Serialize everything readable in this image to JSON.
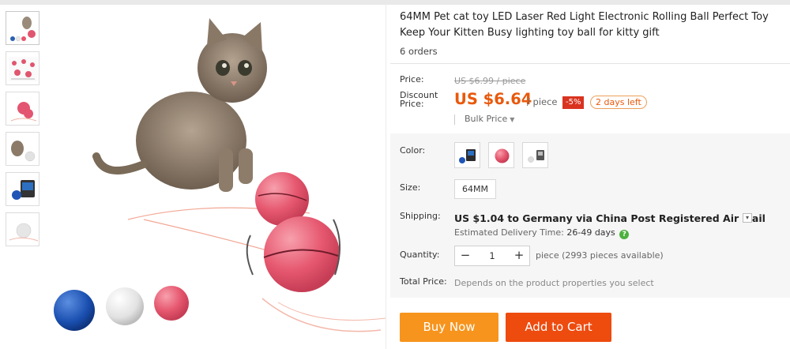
{
  "product": {
    "title": "64MM Pet cat toy LED Laser Red Light Electronic Rolling Ball Perfect Toy Keep Your Kitten Busy lighting toy ball for kitty gift",
    "orders": "6 orders"
  },
  "price": {
    "price_label": "Price:",
    "original": "US $6.99 / piece",
    "discount_label_line1": "Discount",
    "discount_label_line2": "Price:",
    "current": "US $6.64",
    "per_piece": "/ piece",
    "discount_badge": "-5%",
    "days_left": "2 days left",
    "bulk_label": "Bulk Price"
  },
  "options": {
    "color_label": "Color:",
    "colors": [
      "blue-ball",
      "pink-ball",
      "white-ball"
    ],
    "size_label": "Size:",
    "size_value": "64MM",
    "shipping_label": "Shipping:",
    "shipping_text": "US $1.04 to Germany via China Post Registered Air Mail",
    "delivery_prefix": "Estimated Delivery Time:",
    "delivery_days": "26-49 days",
    "help_icon": "?",
    "quantity_label": "Quantity:",
    "quantity_minus": "−",
    "quantity_value": "1",
    "quantity_plus": "+",
    "quantity_note": "piece (2993 pieces available)",
    "total_label": "Total Price:",
    "total_note": "Depends on the product properties you select"
  },
  "actions": {
    "buy_now": "Buy Now",
    "add_to_cart": "Add to Cart"
  },
  "colors": {
    "accent_orange": "#e8590c",
    "buy_button": "#f7941d",
    "cart_button": "#ee4b0f",
    "discount_badge": "#d9331f"
  }
}
